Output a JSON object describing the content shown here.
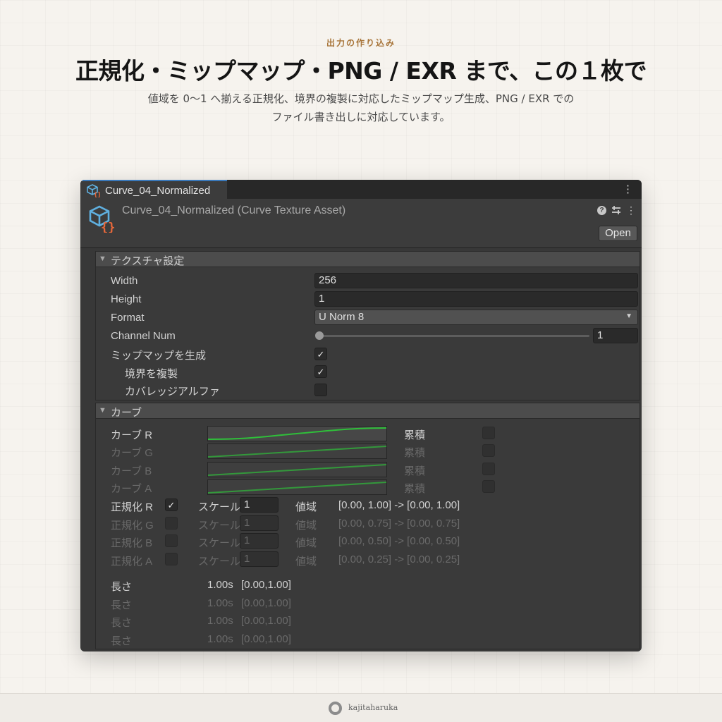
{
  "hero": {
    "eyebrow": "出力の作り込み",
    "headline": "正規化・ミップマップ・PNG / EXR まで、この１枚で",
    "subtitle_line1": "値域を 0〜1 へ揃える正規化、境界の複製に対応したミップマップ生成、PNG / EXR での",
    "subtitle_line2": "ファイル書き出しに対応しています。"
  },
  "window": {
    "tab_label": "Curve_04_Normalized",
    "tab_menu": "⋮",
    "asset_title": "Curve_04_Normalized (Curve Texture Asset)",
    "help": "?",
    "kebab": "⋮",
    "open_label": "Open"
  },
  "texture_settings": {
    "title": "テクスチャ設定",
    "fold": "▼",
    "width_label": "Width",
    "width_value": "256",
    "height_label": "Height",
    "height_value": "1",
    "format_label": "Format",
    "format_value": "U Norm 8",
    "format_caret": "▼",
    "channel_label": "Channel Num",
    "channel_value": "1",
    "mipmap_label": "ミップマップを生成",
    "mipmap_checked": "✓",
    "border_label": "境界を複製",
    "border_checked": "✓",
    "coverage_label": "カバレッジアルファ",
    "coverage_checked": ""
  },
  "curves": {
    "title": "カーブ",
    "fold": "▼",
    "curve_color": "#2fbf3a",
    "rows": [
      {
        "label": "カーブ R",
        "accum_label": "累積"
      },
      {
        "label": "カーブ G",
        "accum_label": "累積"
      },
      {
        "label": "カーブ B",
        "accum_label": "累積"
      },
      {
        "label": "カーブ A",
        "accum_label": "累積"
      }
    ],
    "normalize": [
      {
        "label": "正規化 R",
        "checked": "✓",
        "scale_label": "スケール",
        "scale_value": "1",
        "range_label": "値域",
        "range_value": "[0.00, 1.00] -> [0.00, 1.00]"
      },
      {
        "label": "正規化 G",
        "checked": "",
        "scale_label": "スケール",
        "scale_value": "1",
        "range_label": "値域",
        "range_value": "[0.00, 0.75] -> [0.00, 0.75]"
      },
      {
        "label": "正規化 B",
        "checked": "",
        "scale_label": "スケール",
        "scale_value": "1",
        "range_label": "値域",
        "range_value": "[0.00, 0.50] -> [0.00, 0.50]"
      },
      {
        "label": "正規化 A",
        "checked": "",
        "scale_label": "スケール",
        "scale_value": "1",
        "range_label": "値域",
        "range_value": "[0.00, 0.25] -> [0.00, 0.25]"
      }
    ],
    "lengths": [
      {
        "label": "長さ",
        "value": "1.00s",
        "range": "[0.00,1.00]"
      },
      {
        "label": "長さ",
        "value": "1.00s",
        "range": "[0.00,1.00]"
      },
      {
        "label": "長さ",
        "value": "1.00s",
        "range": "[0.00,1.00]"
      },
      {
        "label": "長さ",
        "value": "1.00s",
        "range": "[0.00,1.00]"
      }
    ]
  },
  "footer": {
    "brand": "kajitaharuka"
  }
}
